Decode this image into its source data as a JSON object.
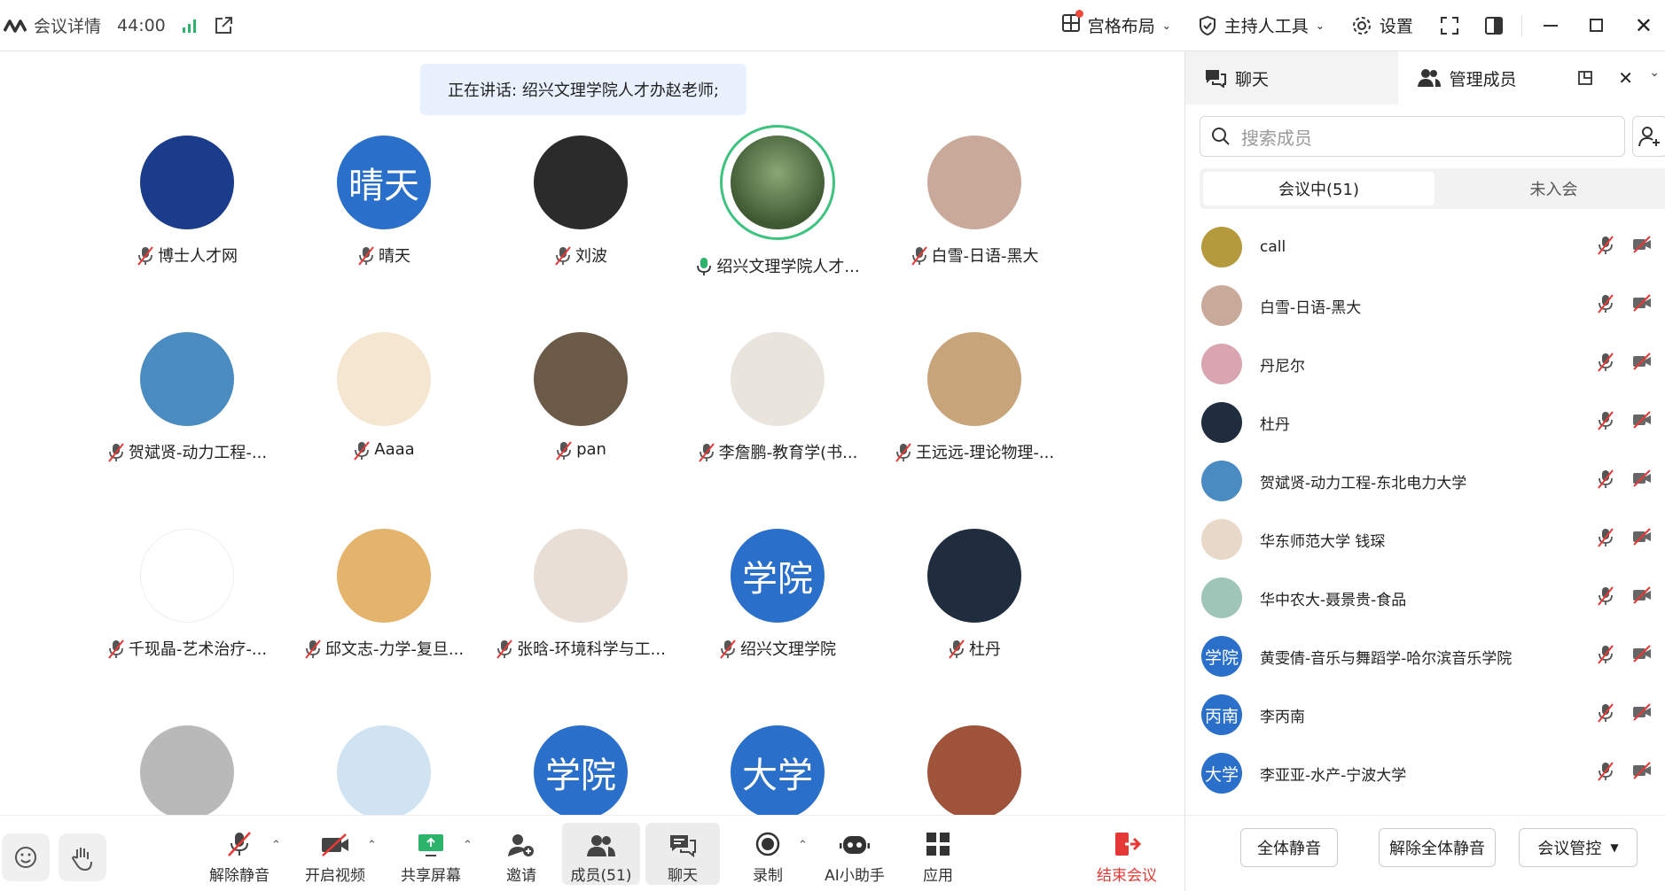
{
  "topbar": {
    "meeting_details": "会议详情",
    "timer": "44:00",
    "layout": "宫格布局",
    "host_tools": "主持人工具",
    "settings": "设置"
  },
  "speaking": "正在讲话: 绍兴文理学院人才办赵老师;",
  "tiles": [
    {
      "name": "博士人才网",
      "avatar_bg": "#1a3c8a",
      "avatar_text": ""
    },
    {
      "name": "晴天",
      "avatar_bg": "#2a6fc9",
      "avatar_text": "晴天"
    },
    {
      "name": "刘波",
      "avatar_bg": "#2b2b2b",
      "avatar_text": ""
    },
    {
      "name": "绍兴文理学院人才...",
      "avatar_bg": "#5e7c4b",
      "avatar_text": ""
    },
    {
      "name": "白雪-日语-黑大",
      "avatar_bg": "#c9a99a",
      "avatar_text": ""
    },
    {
      "name": "贺斌贤-动力工程-...",
      "avatar_bg": "#4a8bc2",
      "avatar_text": ""
    },
    {
      "name": "Aaaa",
      "avatar_bg": "#f4e6d0",
      "avatar_text": ""
    },
    {
      "name": "pan",
      "avatar_bg": "#6b5a48",
      "avatar_text": ""
    },
    {
      "name": "李詹鹏-教育学(书...",
      "avatar_bg": "#e9e4dc",
      "avatar_text": ""
    },
    {
      "name": "王远远-理论物理-...",
      "avatar_bg": "#c8a47a",
      "avatar_text": ""
    },
    {
      "name": "千现晶-艺术治疗-...",
      "avatar_bg": "#ffffff",
      "avatar_text": ""
    },
    {
      "name": "邱文志-力学-复旦...",
      "avatar_bg": "#e4b36c",
      "avatar_text": ""
    },
    {
      "name": "张晗-环境科学与工...",
      "avatar_bg": "#e9ded6",
      "avatar_text": ""
    },
    {
      "name": "绍兴文理学院",
      "avatar_bg": "#2a6fc9",
      "avatar_text": "学院"
    },
    {
      "name": "杜丹",
      "avatar_bg": "#1f2d3e",
      "avatar_text": ""
    },
    {
      "name": "",
      "avatar_bg": "#b9b9b9",
      "avatar_text": ""
    },
    {
      "name": "",
      "avatar_bg": "#cfe3f3",
      "avatar_text": ""
    },
    {
      "name": "",
      "avatar_bg": "#2a6fc9",
      "avatar_text": "学院"
    },
    {
      "name": "",
      "avatar_bg": "#2a6fc9",
      "avatar_text": "大学"
    },
    {
      "name": "",
      "avatar_bg": "#a0533b",
      "avatar_text": ""
    }
  ],
  "bottom": {
    "unmute": "解除静音",
    "video": "开启视频",
    "share": "共享屏幕",
    "invite": "邀请",
    "members": "成员(51)",
    "chat": "聊天",
    "record": "录制",
    "ai": "AI小助手",
    "apps": "应用",
    "end": "结束会议"
  },
  "side": {
    "tab_chat": "聊天",
    "tab_members": "管理成员",
    "search_placeholder": "搜索成员",
    "in_meeting": "会议中(51)",
    "not_joined": "未入会",
    "members": [
      {
        "name": "call",
        "bg": "#b59a3d",
        "text": ""
      },
      {
        "name": "白雪-日语-黑大",
        "bg": "#c9a99a",
        "text": ""
      },
      {
        "name": "丹尼尔",
        "bg": "#d9a5b0",
        "text": ""
      },
      {
        "name": "杜丹",
        "bg": "#1f2d3e",
        "text": ""
      },
      {
        "name": "贺斌贤-动力工程-东北电力大学",
        "bg": "#4a8bc2",
        "text": ""
      },
      {
        "name": "华东师范大学 钱琛",
        "bg": "#e8d8c8",
        "text": ""
      },
      {
        "name": "华中农大-聂景贵-食品",
        "bg": "#9fc4b8",
        "text": ""
      },
      {
        "name": "黄雯倩-音乐与舞蹈学-哈尔滨音乐学院",
        "bg": "#2a6fc9",
        "text": "学院"
      },
      {
        "name": "李丙南",
        "bg": "#2a6fc9",
        "text": "丙南"
      },
      {
        "name": "李亚亚-水产-宁波大学",
        "bg": "#2a6fc9",
        "text": "大学"
      }
    ],
    "mute_all": "全体静音",
    "unmute_all": "解除全体静音",
    "control": "会议管控"
  }
}
